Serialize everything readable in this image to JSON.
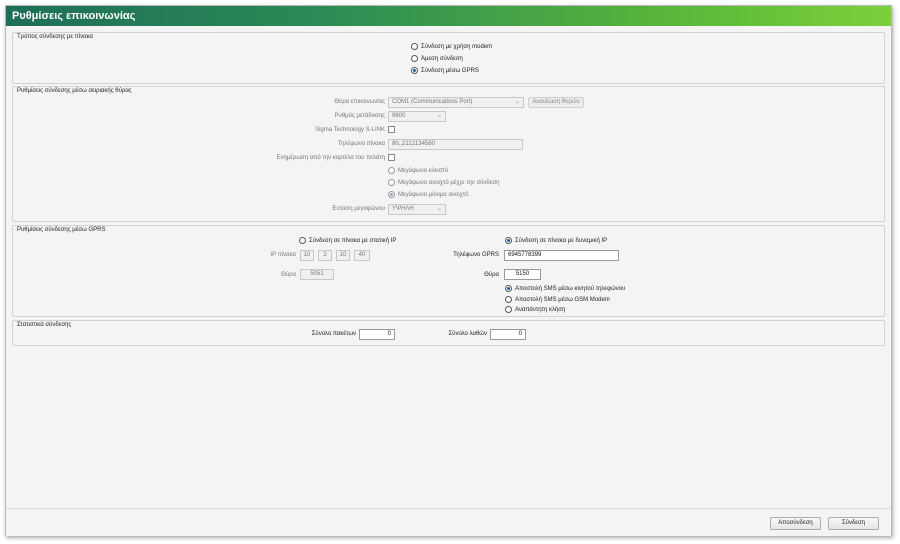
{
  "window": {
    "title": "Ρυθμίσεις επικοινωνίας"
  },
  "connection_mode": {
    "legend": "Τρόπος σύνδεσης με πίνακα",
    "options": [
      {
        "label": "Σύνδεση με χρήση modem",
        "selected": false
      },
      {
        "label": "Άμεση σύνδεση",
        "selected": false
      },
      {
        "label": "Σύνδεση μέσω GPRS",
        "selected": true
      }
    ]
  },
  "serial": {
    "legend": "Ρυθμίσεις σύνδεσης μέσω σειριακής θύρας",
    "port_label": "Θύρα επικοινωνίας",
    "port_value": "COM1 (Communications Port)",
    "scan_button": "Ανανέωση θυρών",
    "speed_label": "Ρυθμός μετάδοσης",
    "speed_value": "9600",
    "slink_label": "Sigma Technology S-LINK",
    "phone_label": "Τηλέφωνο πίνακα",
    "phone_value": "80,,2112134580",
    "update_label": "Ενημέρωση από την καρτέλα του πελάτη",
    "speaker_options": [
      {
        "label": "Μεγάφωνο κλειστό",
        "selected": false
      },
      {
        "label": "Μεγάφωνο ανοιχτό μέχρι την σύνδεση",
        "selected": false
      },
      {
        "label": "Μεγάφωνο μόνιμα ανοιχτό",
        "selected": true
      }
    ],
    "volume_label": "Ένταση μεγαφώνου",
    "volume_value": "ΥΨΗΛΗ"
  },
  "gprs": {
    "legend": "Ρυθμίσεις σύνδεσης μέσω GPRS",
    "static_ip_option": {
      "label": "Σύνδεση σε πίνακα με στατική IP",
      "selected": false
    },
    "dynamic_ip_option": {
      "label": "Σύνδεση σε πίνακα με δυναμική IP",
      "selected": true
    },
    "ip_label": "IP πίνακα",
    "ip_octets": [
      "10",
      "2",
      "10",
      "40"
    ],
    "static_port_label": "Θύρα",
    "static_port_value": "5051",
    "phone_label": "Τηλέφωνο GPRS",
    "phone_value": "6945778399",
    "port_label": "Θύρα",
    "port_value": "5150",
    "notify_options": [
      {
        "label": "Αποστολή SMS μέσω κινητού τηλεφώνου",
        "selected": true
      },
      {
        "label": "Αποστολή SMS μέσω GSM Modem",
        "selected": false
      },
      {
        "label": "Αναπάντητη κλήση",
        "selected": false
      }
    ]
  },
  "stats": {
    "legend": "Στατιστικά σύνδεσης",
    "packets_label": "Σύνολο πακέτων",
    "packets_value": "0",
    "errors_label": "Σύνολο λαθών",
    "errors_value": "0"
  },
  "footer": {
    "disconnect_button": "Αποσύνδεση",
    "connect_button": "Σύνδεση"
  }
}
